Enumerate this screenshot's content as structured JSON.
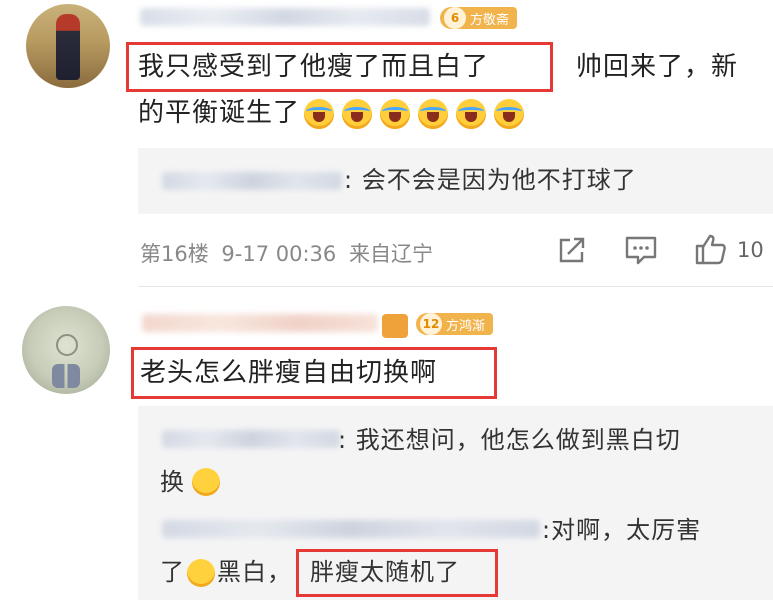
{
  "comments": [
    {
      "badge_level": "6",
      "badge_text": "方敬斋",
      "highlighted": "我只感受到了他瘦了而且白了",
      "line1_rest": "帅回来了，新",
      "line2": "的平衡诞生了",
      "emoji_count": 6,
      "reply_text": ": 会不会是因为他不打球了",
      "floor": "第16楼",
      "time": "9-17 00:36",
      "location": "来自辽宁",
      "like_count": "10"
    },
    {
      "badge_level": "12",
      "badge_text": "方鸿渐",
      "highlighted": "老头怎么胖瘦自由切换啊",
      "reply1_line1": ": 我还想问，他怎么做到黑白切",
      "reply1_line2": "换",
      "reply2_line1": ":对啊，太厉害",
      "reply2_line2_a": "了",
      "reply2_line2_b": "黑白，",
      "reply2_highlight": "胖瘦太随机了"
    }
  ],
  "icons": [
    "share-icon",
    "comment-icon",
    "like-icon"
  ],
  "colors": {
    "highlight_border": "#e53935",
    "badge": "#f1b34c",
    "reply_bg": "#f4f4f5"
  }
}
